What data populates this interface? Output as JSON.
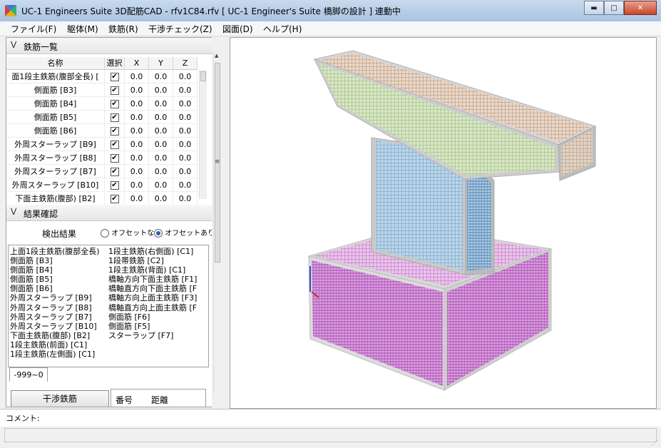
{
  "window": {
    "title": "UC-1 Engineers Suite 3D配筋CAD - rfv1C84.rfv [ UC-1 Engineer's Suite 橋脚の設計 ] 連動中",
    "min_symbol": "▬",
    "max_symbol": "□",
    "close_symbol": "✕"
  },
  "menu": [
    {
      "label": "ファイル(F)"
    },
    {
      "label": "躯体(M)"
    },
    {
      "label": "鉄筋(R)"
    },
    {
      "label": "干渉チェック(Z)"
    },
    {
      "label": "図面(D)"
    },
    {
      "label": "ヘルプ(H)"
    }
  ],
  "rebar_list": {
    "section_title": "鉄筋一覧",
    "columns": [
      "名称",
      "選択",
      "X",
      "Y",
      "Z"
    ],
    "rows": [
      {
        "name": "面1段主鉄筋(腹部全長) [",
        "checked": true,
        "x": "0.0",
        "y": "0.0",
        "z": "0.0"
      },
      {
        "name": "側面筋 [B3]",
        "checked": true,
        "x": "0.0",
        "y": "0.0",
        "z": "0.0"
      },
      {
        "name": "側面筋 [B4]",
        "checked": true,
        "x": "0.0",
        "y": "0.0",
        "z": "0.0"
      },
      {
        "name": "側面筋 [B5]",
        "checked": true,
        "x": "0.0",
        "y": "0.0",
        "z": "0.0"
      },
      {
        "name": "側面筋 [B6]",
        "checked": true,
        "x": "0.0",
        "y": "0.0",
        "z": "0.0"
      },
      {
        "name": "外周スターラップ [B9]",
        "checked": true,
        "x": "0.0",
        "y": "0.0",
        "z": "0.0"
      },
      {
        "name": "外周スターラップ [B8]",
        "checked": true,
        "x": "0.0",
        "y": "0.0",
        "z": "0.0"
      },
      {
        "name": "外周スターラップ [B7]",
        "checked": true,
        "x": "0.0",
        "y": "0.0",
        "z": "0.0"
      },
      {
        "name": "外周スターラップ [B10]",
        "checked": true,
        "x": "0.0",
        "y": "0.0",
        "z": "0.0"
      },
      {
        "name": "下面主鉄筋(腹部) [B2]",
        "checked": true,
        "x": "0.0",
        "y": "0.0",
        "z": "0.0"
      }
    ]
  },
  "result_check": {
    "section_title": "結果確認",
    "detect_label": "検出結果",
    "radio_no_offset": "オフセットなし",
    "radio_with_offset": "オフセットあり",
    "selected_radio": "with_offset",
    "results_col1": [
      "上面1段主鉄筋(腹部全長)",
      "側面筋 [B3]",
      "側面筋 [B4]",
      "側面筋 [B5]",
      "側面筋 [B6]",
      "外周スターラップ [B9]",
      "外周スターラップ [B8]",
      "外周スターラップ [B7]",
      "外周スターラップ [B10]",
      "下面主鉄筋(腹部) [B2]",
      "1段主鉄筋(前面) [C1]",
      "1段主鉄筋(左側面) [C1]"
    ],
    "results_col2": [
      "1段主鉄筋(右側面) [C1]",
      "1段帯鉄筋 [C2]",
      "1段主鉄筋(背面) [C1]",
      "橋軸方向下面主鉄筋 [F1]",
      "橋軸直方向下面主鉄筋 [F",
      "橋軸方向上面主鉄筋 [F3]",
      "橋軸直方向上面主鉄筋 [F",
      "側面筋 [F6]",
      "側面筋 [F5]",
      "スターラップ [F7]"
    ],
    "range_tab": "-999~0",
    "interference_button": "干渉鉄筋",
    "table_headers": [
      "番号",
      "距離"
    ]
  },
  "comment_label": "コメント:",
  "colors": {
    "titlebar": "#b8cfe8",
    "close_button": "#c9452c",
    "footing_rebar": "#d46fd0",
    "column_rebar": "#6aa8d8",
    "beam_rebar_top": "#c8a07a",
    "beam_rebar_bottom": "#8cc46a"
  }
}
